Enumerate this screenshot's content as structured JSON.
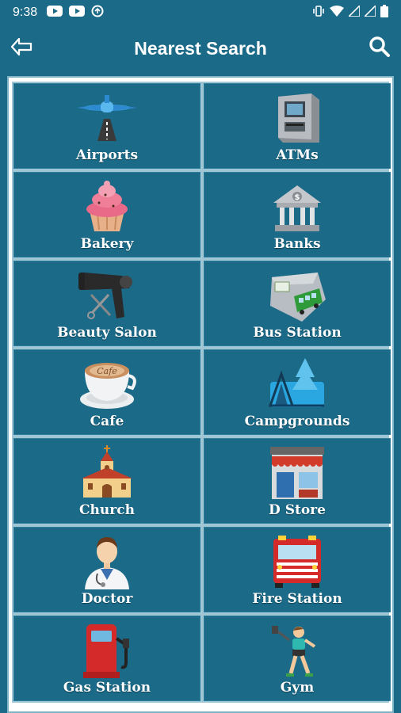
{
  "status": {
    "time": "9:38"
  },
  "header": {
    "title": "Nearest Search"
  },
  "colors": {
    "background": "#1b6a88",
    "frame": "#ffffff",
    "divider": "#9ec6d4"
  },
  "tiles": [
    {
      "label": "Airports",
      "icon": "airplane-icon"
    },
    {
      "label": "ATMs",
      "icon": "atm-icon"
    },
    {
      "label": "Bakery",
      "icon": "cupcake-icon"
    },
    {
      "label": "Banks",
      "icon": "bank-icon"
    },
    {
      "label": "Beauty Salon",
      "icon": "hair-dryer-icon"
    },
    {
      "label": "Bus Station",
      "icon": "bus-icon"
    },
    {
      "label": "Cafe",
      "icon": "coffee-cup-icon"
    },
    {
      "label": "Campgrounds",
      "icon": "tent-icon"
    },
    {
      "label": "Church",
      "icon": "church-icon"
    },
    {
      "label": "D Store",
      "icon": "store-icon"
    },
    {
      "label": "Doctor",
      "icon": "doctor-icon"
    },
    {
      "label": "Fire Station",
      "icon": "fire-truck-icon"
    },
    {
      "label": "Gas Station",
      "icon": "gas-pump-icon"
    },
    {
      "label": "Gym",
      "icon": "gym-icon"
    }
  ]
}
